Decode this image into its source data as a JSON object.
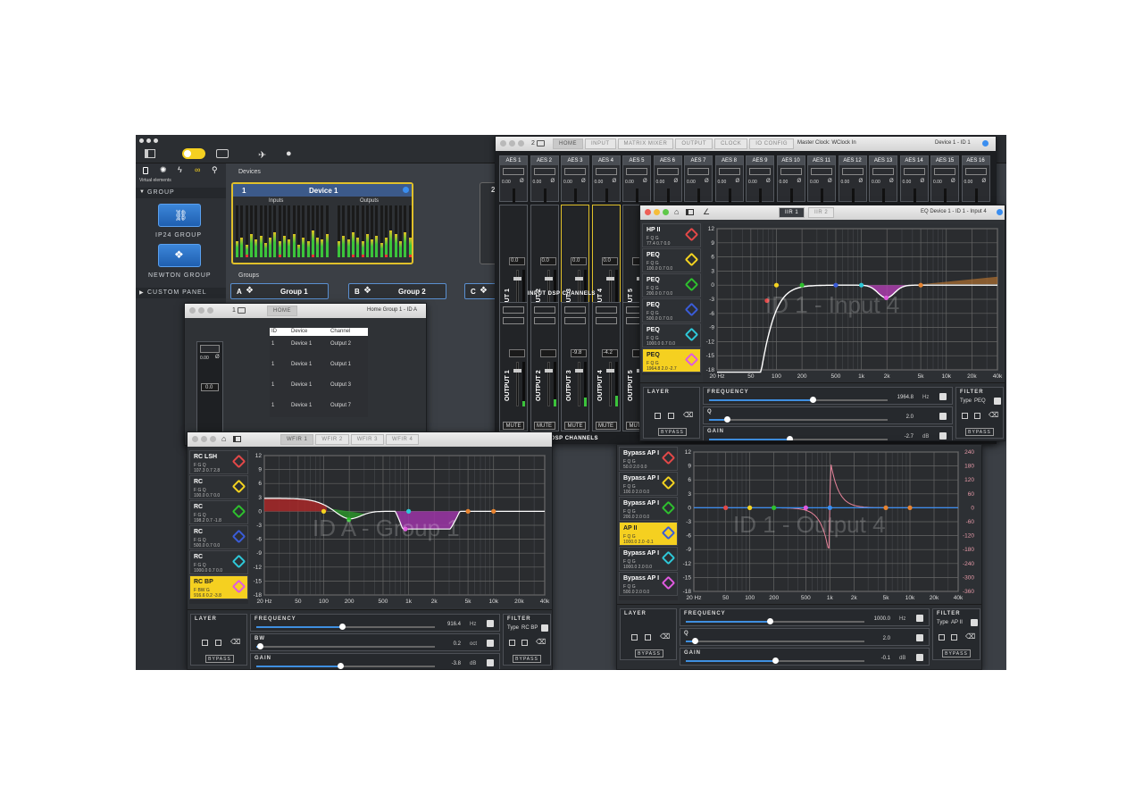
{
  "main": {
    "virtual_elements_label": "Virtual elements",
    "group_label": "GROUP",
    "ip24_group_label": "IP24 GROUP",
    "newton_group_label": "NEWTON GROUP",
    "custom_panel_label": "CUSTOM PANEL",
    "devices_label": "Devices",
    "device1": {
      "id": "1",
      "name": "Device 1",
      "inputs_label": "Inputs",
      "outputs_label": "Outputs"
    },
    "device2_id": "2",
    "groups_label": "Groups",
    "groups": [
      {
        "letter": "A",
        "name": "Group 1"
      },
      {
        "letter": "B",
        "name": "Group 2"
      },
      {
        "letter": "C",
        "name": ""
      }
    ]
  },
  "mixer": {
    "id_label": "2",
    "tabs": [
      "HOME",
      "INPUT",
      "MATRIX MIXER",
      "OUTPUT",
      "CLOCK",
      "IO CONFIG"
    ],
    "master_clock": "Master Clock: WClock In",
    "device_label": "Device 1 - ID 1",
    "aes": [
      "AES 1",
      "AES 2",
      "AES 3",
      "AES 4",
      "AES 5",
      "AES 6",
      "AES 7",
      "AES 8",
      "AES 9",
      "AES 10",
      "AES 11",
      "AES 12",
      "AES 13",
      "AES 14",
      "AES 15",
      "AES 16"
    ],
    "inputs": [
      {
        "name": "INPUT 1",
        "gain": "0.0",
        "mute": "MUTE",
        "muted": false
      },
      {
        "name": "INPUT 2",
        "gain": "0.0",
        "mute": "MUTE",
        "muted": true
      },
      {
        "name": "INPUT 3",
        "gain": "0.0",
        "mute": "MUTE",
        "muted": false
      },
      {
        "name": "INPUT 4",
        "gain": "0.0",
        "mute": "MUTE",
        "muted": false
      },
      {
        "name": "INPUT 5",
        "gain": "",
        "mute": "MUTE",
        "muted": false
      }
    ],
    "input_section_label": "INPUT DSP CHANNELS",
    "outputs": [
      {
        "name": "OUTPUT 1",
        "gain": "",
        "mute": "MUTE"
      },
      {
        "name": "OUTPUT 2",
        "gain": "",
        "mute": "MUTE"
      },
      {
        "name": "OUTPUT 3",
        "gain": "-9.8",
        "mute": "MUTE"
      },
      {
        "name": "OUTPUT 4",
        "gain": "-4.2",
        "mute": "MUTE"
      },
      {
        "name": "OUTPUT 5",
        "gain": "",
        "mute": "MUTE"
      }
    ],
    "output_section_label": "OUTPUT DSP CHANNELS",
    "zero": "0.00",
    "phase": "Ø"
  },
  "eq_input": {
    "tabs": [
      "IIR 1",
      "IIR 2"
    ],
    "title": "EQ Device 1 - ID 1 - Input 4",
    "watermark": "ID 1 - Input 4",
    "filters": [
      {
        "name": "HP II",
        "params": "F  Q  G",
        "vals": "77.4  0.7  0.0",
        "color": "#e34848"
      },
      {
        "name": "PEQ",
        "params": "F  Q  G",
        "vals": "100.0  0.7  0.0",
        "color": "#f4d320"
      },
      {
        "name": "PEQ",
        "params": "F  Q  G",
        "vals": "200.0  0.7  0.0",
        "color": "#2ec02e"
      },
      {
        "name": "PEQ",
        "params": "F  Q  G",
        "vals": "500.0  0.7  0.0",
        "color": "#3a5cd8"
      },
      {
        "name": "PEQ",
        "params": "F  Q  G",
        "vals": "1000.0  0.7  0.0",
        "color": "#2ec8d8"
      },
      {
        "name": "PEQ",
        "params": "F  Q  G",
        "vals": "1964.8  2.0  -2.7",
        "color": "#e05adf"
      }
    ],
    "y_ticks": [
      "12",
      "9",
      "6",
      "3",
      "0",
      "-3",
      "-6",
      "-9",
      "-12",
      "-15",
      "-18"
    ],
    "x_ticks": [
      "20 Hz",
      "50",
      "100",
      "200",
      "500",
      "1k",
      "2k",
      "5k",
      "10k",
      "20k",
      "40k"
    ],
    "layer_label": "LAYER",
    "bypass_label": "BYPASS",
    "frequency_label": "FREQUENCY",
    "frequency_value": "1964.8",
    "frequency_unit": "Hz",
    "frequency_fraction": 0.58,
    "q_label": "Q",
    "q_value": "2.0",
    "q_fraction": 0.1,
    "gain_label": "GAIN",
    "gain_value": "-2.7",
    "gain_unit": "dB",
    "gain_fraction": 0.45,
    "filter_label": "FILTER",
    "type_label": "Type",
    "type_value": "PEQ"
  },
  "home_group": {
    "id_label": "1",
    "tab": "HOME",
    "title": "Home Group 1 - ID A",
    "zero": "0.00",
    "gain": "0.0",
    "table_headers": [
      "ID",
      "Device",
      "Channel"
    ],
    "table_rows": [
      [
        "1",
        "Device 1",
        "Output 2"
      ],
      [
        "1",
        "Device 1",
        "Output 1"
      ],
      [
        "1",
        "Device 1",
        "Output 3"
      ],
      [
        "1",
        "Device 1",
        "Output 7"
      ]
    ]
  },
  "wfir": {
    "tabs": [
      "WFIR 1",
      "WFIR 2",
      "WFIR 3",
      "WFIR 4"
    ],
    "watermark": "ID A - Group 1",
    "filters": [
      {
        "name": "RC LSH",
        "params": "F  G  Q",
        "vals": "107.3  0.7  2.8",
        "color": "#e34848"
      },
      {
        "name": "RC",
        "params": "F  G  Q",
        "vals": "100.0  0.7  0.0",
        "color": "#f4d320"
      },
      {
        "name": "RC",
        "params": "F  G  Q",
        "vals": "198.2  0.7  -1.8",
        "color": "#2ec02e"
      },
      {
        "name": "RC",
        "params": "F  G  Q",
        "vals": "500.0  0.7  0.0",
        "color": "#3a5cd8"
      },
      {
        "name": "RC",
        "params": "F  G  Q",
        "vals": "1000.0  0.7  0.0",
        "color": "#2ec8d8"
      },
      {
        "name": "RC BP",
        "params": "F  BW  G",
        "vals": "916.6  0.2  -3.8",
        "color": "#e05adf"
      }
    ],
    "y_ticks": [
      "12",
      "9",
      "6",
      "3",
      "0",
      "-3",
      "-6",
      "-9",
      "-12",
      "-15",
      "-18"
    ],
    "x_ticks": [
      "20 Hz",
      "50",
      "100",
      "200",
      "500",
      "1k",
      "2k",
      "5k",
      "10k",
      "20k",
      "40k"
    ],
    "layer_label": "LAYER",
    "bypass_label": "BYPASS",
    "frequency_label": "FREQUENCY",
    "frequency_value": "916.4",
    "frequency_unit": "Hz",
    "frequency_fraction": 0.48,
    "bw_label": "BW",
    "bw_value": "0.2",
    "bw_unit": "oct",
    "bw_fraction": 0.02,
    "gain_label": "GAIN",
    "gain_value": "-3.8",
    "gain_unit": "dB",
    "gain_fraction": 0.47,
    "filter_label": "FILTER",
    "type_label": "Type",
    "type_value": "RC BP"
  },
  "ap": {
    "watermark": "ID 1 - Output 4",
    "filters": [
      {
        "name": "Bypass AP I",
        "params": "F  Q  G",
        "vals": "50.0  2.0  0.0",
        "color": "#e34848"
      },
      {
        "name": "Bypass AP I",
        "params": "F  Q  G",
        "vals": "100.0  2.0  0.0",
        "color": "#f4d320"
      },
      {
        "name": "Bypass AP I",
        "params": "F  Q  G",
        "vals": "200.0  2.0  0.0",
        "color": "#2ec02e"
      },
      {
        "name": "AP II",
        "params": "F  Q  G",
        "vals": "1000.0  2.0  -0.1",
        "color": "#3a5cd8"
      },
      {
        "name": "Bypass AP I",
        "params": "F  Q  G",
        "vals": "1000.0  2.0  0.0",
        "color": "#2ec8d8"
      },
      {
        "name": "Bypass AP I",
        "params": "F  Q  G",
        "vals": "500.0  2.0  0.0",
        "color": "#e05adf"
      }
    ],
    "y_ticks": [
      "12",
      "9",
      "6",
      "3",
      "0",
      "-3",
      "-6",
      "-9",
      "-12",
      "-15",
      "-18"
    ],
    "phase_ticks": [
      "240",
      "180",
      "120",
      "60",
      "0",
      "-60",
      "-120",
      "-180",
      "-240",
      "-300",
      "-360"
    ],
    "x_ticks": [
      "20 Hz",
      "50",
      "100",
      "200",
      "500",
      "1k",
      "2k",
      "5k",
      "10k",
      "20k",
      "40k"
    ],
    "layer_label": "LAYER",
    "bypass_label": "BYPASS",
    "frequency_label": "FREQUENCY",
    "frequency_value": "1000.0",
    "frequency_unit": "Hz",
    "frequency_fraction": 0.47,
    "q_label": "Q",
    "q_value": "2.0",
    "q_fraction": 0.05,
    "gain_label": "GAIN",
    "gain_value": "-0.1",
    "gain_unit": "dB",
    "gain_fraction": 0.5,
    "filter_label": "FILTER",
    "type_label": "Type",
    "type_value": "AP II"
  }
}
